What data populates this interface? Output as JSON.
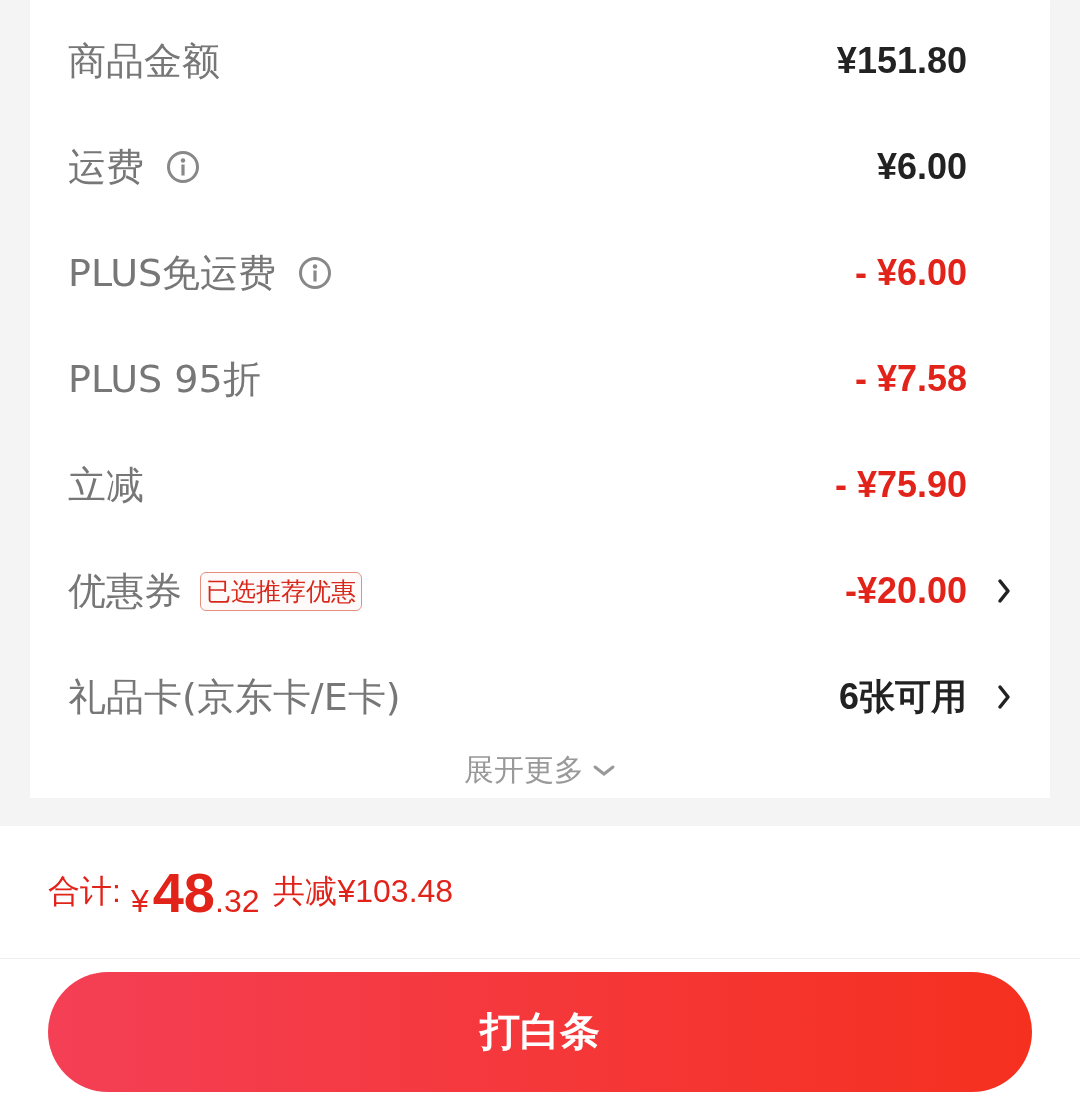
{
  "rows": [
    {
      "label": "商品金额",
      "info": false,
      "value": "¥151.80",
      "kind": "normal",
      "arrow": false
    },
    {
      "label": "运费",
      "info": true,
      "value": "¥6.00",
      "kind": "normal",
      "arrow": false
    },
    {
      "label": "PLUS免运费",
      "info": true,
      "value": "- ¥6.00",
      "kind": "discount",
      "arrow": false
    },
    {
      "label": "PLUS 95折",
      "info": false,
      "value": "- ¥7.58",
      "kind": "discount",
      "arrow": false
    },
    {
      "label": "立减",
      "info": false,
      "value": "- ¥75.90",
      "kind": "discount",
      "arrow": false
    },
    {
      "label": "优惠券",
      "info": false,
      "tag": "已选推荐优惠",
      "value": "-¥20.00",
      "kind": "discount",
      "arrow": true
    },
    {
      "label": "礼品卡(京东卡/E卡)",
      "info": false,
      "value": "6张可用",
      "kind": "normal",
      "arrow": true
    }
  ],
  "expand": {
    "label": "展开更多"
  },
  "total": {
    "label": "合计:",
    "currency": "¥",
    "integer": "48",
    "decimal": ".32",
    "saving": "共减¥103.48"
  },
  "pay_button": {
    "label": "打白条"
  }
}
